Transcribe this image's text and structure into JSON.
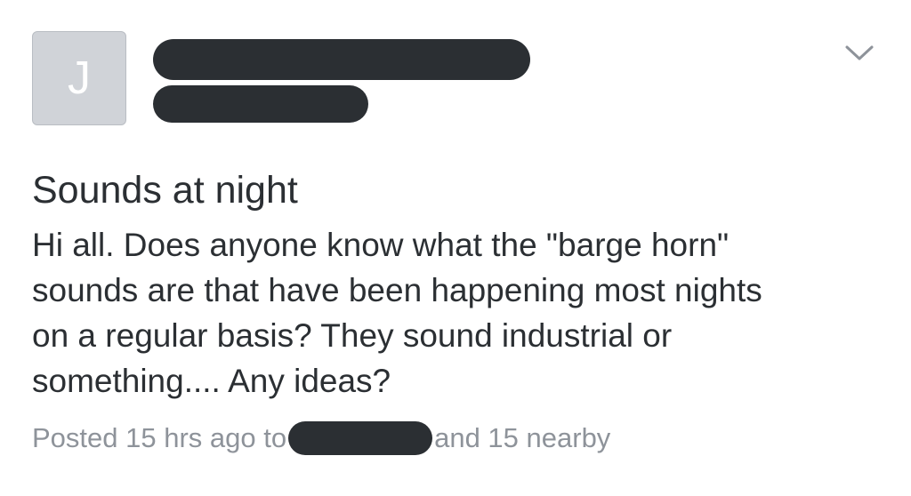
{
  "post": {
    "author_initial": "J",
    "title": "Sounds at night",
    "body_lines": [
      "Hi all. Does anyone know what the \"barge horn\"",
      "sounds are that have been happening most nights",
      "on a regular basis? They sound industrial or",
      "something.... Any ideas?"
    ],
    "footer": {
      "posted_prefix": "Posted 15 hrs ago to",
      "nearby_suffix": "and 15 nearby"
    }
  },
  "icons": {
    "menu": "chevron-down-icon"
  },
  "colors": {
    "text": "#2b2f33",
    "muted": "#8e939a",
    "avatar_bg": "#d0d3d8",
    "redaction": "#2b2f33"
  }
}
